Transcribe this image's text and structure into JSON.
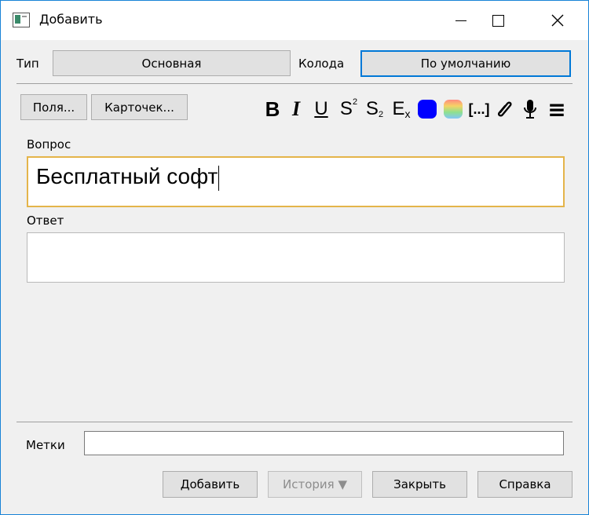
{
  "window": {
    "title": "Добавить"
  },
  "header": {
    "type_label": "Тип",
    "type_value": "Основная",
    "deck_label": "Колода",
    "deck_value": "По умолчанию"
  },
  "editor": {
    "fields_button": "Поля...",
    "cards_button": "Карточек...",
    "toolbar": {
      "bold": "B",
      "italic": "I",
      "underline": "U",
      "superscript": "S",
      "superscript_mark": "2",
      "subscript": "S",
      "subscript_mark": "2",
      "clear_format": "E",
      "clear_mark": "x",
      "cloze": "[...]",
      "menu_icon": "≡",
      "text_color": "#0000ff"
    },
    "fields": [
      {
        "label": "Вопрос",
        "value": "Бесплатный софт"
      },
      {
        "label": "Ответ",
        "value": ""
      }
    ]
  },
  "tags": {
    "label": "Метки",
    "value": ""
  },
  "buttons": {
    "add": "Добавить",
    "history": "История ▼",
    "close": "Закрыть",
    "help": "Справка"
  }
}
